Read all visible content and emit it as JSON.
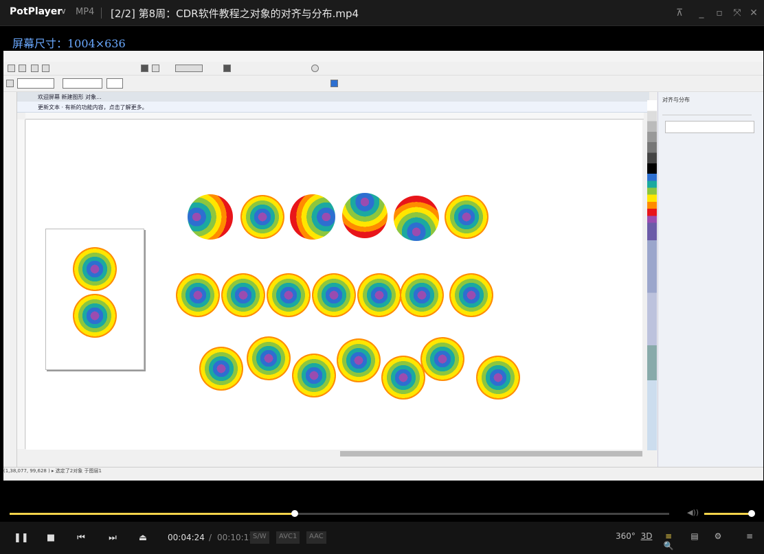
{
  "titlebar": {
    "brand": "PotPlayer",
    "brand_caret": "∨",
    "format": "MP4",
    "title": "[2/2] 第8周：CDR软件教程之对象的对齐与分布.mp4",
    "buttons": [
      "pin",
      "minimize",
      "restore",
      "fullscreen",
      "close"
    ]
  },
  "overlay": {
    "screen_size": "屏幕尺寸：1004×636"
  },
  "cdr": {
    "tabs": "欢迎屏幕   新建图形   对象...",
    "tip": "更新文本  ·  有新的功能内容，点击了解更多。",
    "docker_title": "对齐与分布",
    "statusbar": "(1,38,077, 99,628 )   ▸    选定了2对象 于图层1"
  },
  "player": {
    "time_current": "00:04:24",
    "time_separator": "/",
    "time_total": "00:10:11",
    "tags": [
      "S/W",
      "AVC1",
      "AAC"
    ],
    "seek_progress": 0.432,
    "volume_level": 1.0,
    "controls": [
      "pause",
      "stop",
      "previous",
      "next",
      "eject"
    ],
    "right_icons": [
      "360",
      "3D",
      "playlist-search",
      "chapters",
      "settings",
      "menu"
    ],
    "label_360": "360°",
    "label_3d": "3D"
  },
  "colors": {
    "accent": "#f3d34a",
    "title_text": "#e6e6e6",
    "overlay_text": "#6aa9ff"
  }
}
